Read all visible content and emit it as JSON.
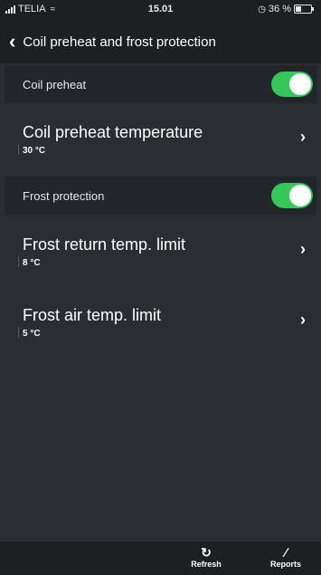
{
  "status_bar": {
    "carrier": "TELIA",
    "time": "15.01",
    "battery": "36 %"
  },
  "nav": {
    "title": "Coil preheat and frost protection"
  },
  "sections": [
    {
      "toggle_label": "Coil preheat",
      "toggle_on": true,
      "settings": [
        {
          "title": "Coil preheat temperature",
          "value": "30 °C"
        }
      ]
    },
    {
      "toggle_label": "Frost protection",
      "toggle_on": true,
      "settings": [
        {
          "title": "Frost return temp. limit",
          "value": "8 °C"
        },
        {
          "title": "Frost air temp. limit",
          "value": "5 °C"
        }
      ]
    }
  ],
  "tab_bar": {
    "refresh_label": "Refresh",
    "reports_label": "Reports"
  },
  "colors": {
    "background": "#2a2d31",
    "bar": "#1d1f22",
    "toggle_on": "#35c759"
  }
}
